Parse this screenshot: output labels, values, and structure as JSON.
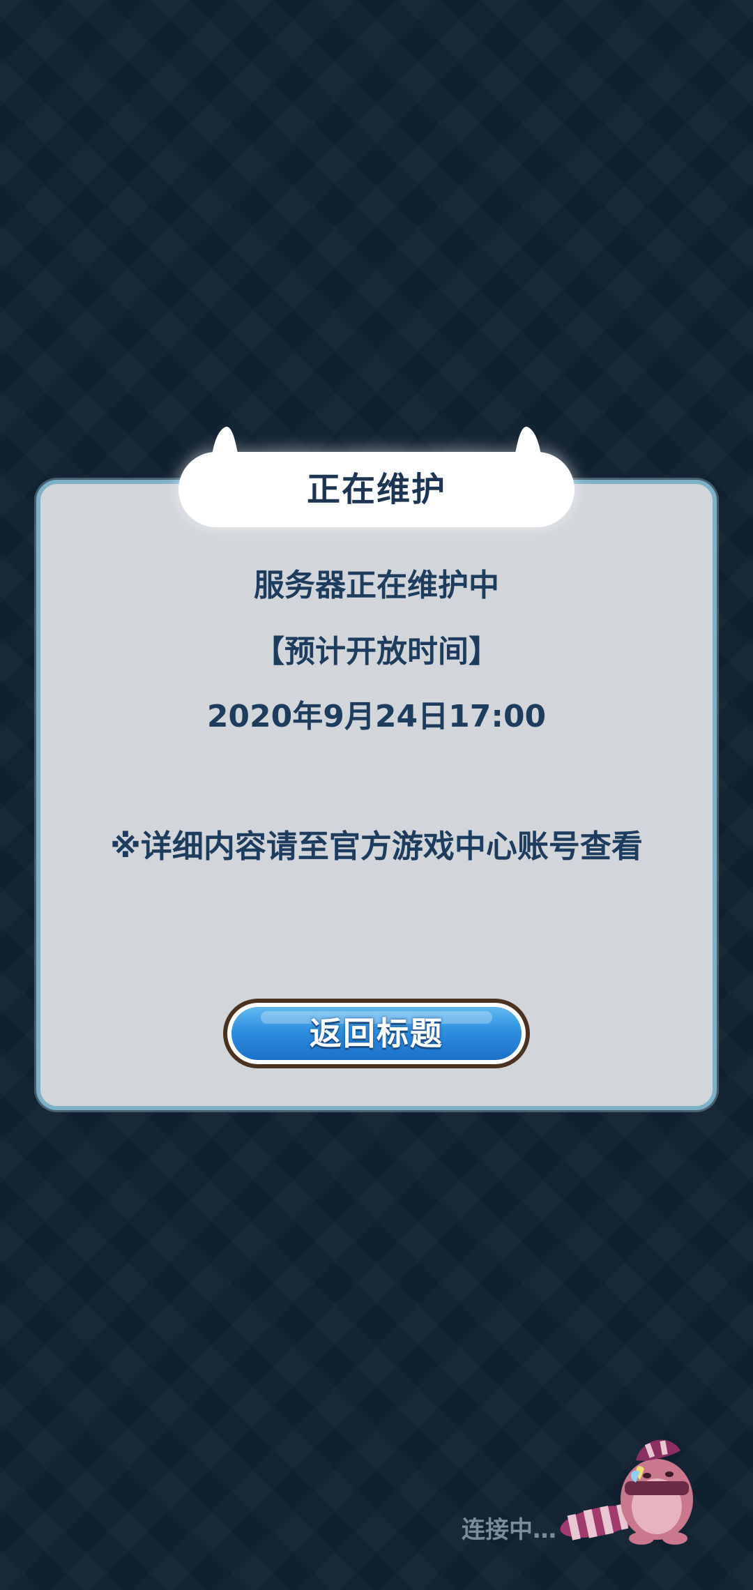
{
  "dialog": {
    "title": "正在维护",
    "line1": "服务器正在维护中",
    "line2": "【预计开放时间】",
    "line3": "2020年9月24日17:00",
    "note": "※详细内容请至官方游戏中心账号查看",
    "button_label": "返回标题"
  },
  "status": {
    "connecting_text": "连接中…"
  },
  "colors": {
    "background": "#10202f",
    "panel": "#d2d6da",
    "panel_border": "#7eb0c8",
    "text": "#1e3d5e",
    "button": "#2d8fe0"
  },
  "icons": {
    "mascot": "raccoon-mascot-icon"
  }
}
